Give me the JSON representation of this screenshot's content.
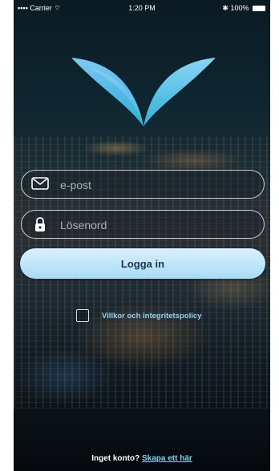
{
  "status_bar": {
    "carrier": "Carrier",
    "time": "1:20 PM",
    "battery": "100%"
  },
  "login_form": {
    "email_placeholder": "e-post",
    "email_value": "",
    "password_placeholder": "Lösenord",
    "password_value": "",
    "login_label": "Logga in"
  },
  "terms": {
    "checked": false,
    "label": "Villkor och integritetspolicy"
  },
  "signup": {
    "prompt": "Inget konto?",
    "link_label": "Skapa ett här"
  },
  "colors": {
    "accent": "#8fd2f5",
    "button": "#b9e3f8",
    "logo_top": "#7ecbf3",
    "logo_bottom": "#33b0d8"
  },
  "icons": {
    "email": "envelope-icon",
    "password": "lock-icon",
    "logo": "wing-v-logo"
  }
}
